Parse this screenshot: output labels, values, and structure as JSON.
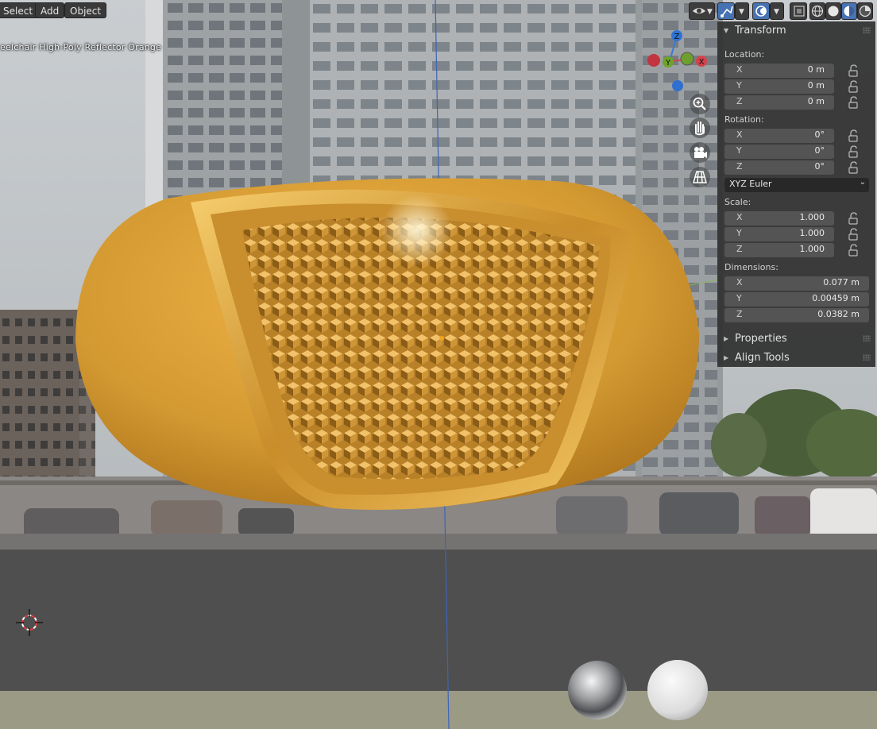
{
  "header": {
    "menus": [
      {
        "label": "Select"
      },
      {
        "label": "Add"
      },
      {
        "label": "Object"
      }
    ]
  },
  "viewport": {
    "object_name": "eelchair High-Poly Reflector Orange",
    "gizmo_axes": {
      "z": "Z",
      "y": "Y",
      "x": "X"
    }
  },
  "npanel": {
    "transform_title": "Transform",
    "location_label": "Location:",
    "location": [
      {
        "axis": "X",
        "value": "0 m"
      },
      {
        "axis": "Y",
        "value": "0 m"
      },
      {
        "axis": "Z",
        "value": "0 m"
      }
    ],
    "rotation_label": "Rotation:",
    "rotation": [
      {
        "axis": "X",
        "value": "0°"
      },
      {
        "axis": "Y",
        "value": "0°"
      },
      {
        "axis": "Z",
        "value": "0°"
      }
    ],
    "rotation_mode": "XYZ Euler",
    "scale_label": "Scale:",
    "scale": [
      {
        "axis": "X",
        "value": "1.000"
      },
      {
        "axis": "Y",
        "value": "1.000"
      },
      {
        "axis": "Z",
        "value": "1.000"
      }
    ],
    "dimensions_label": "Dimensions:",
    "dimensions": [
      {
        "axis": "X",
        "value": "0.077 m"
      },
      {
        "axis": "Y",
        "value": "0.00459 m"
      },
      {
        "axis": "Z",
        "value": "0.0382 m"
      }
    ],
    "properties_title": "Properties",
    "align_tools_title": "Align Tools"
  },
  "colors": {
    "object": "#d69b34",
    "panel": "#303030",
    "active_button": "#4772b3",
    "axis_x": "#d4424c",
    "axis_y": "#6da52a",
    "axis_z": "#2f73d2"
  }
}
